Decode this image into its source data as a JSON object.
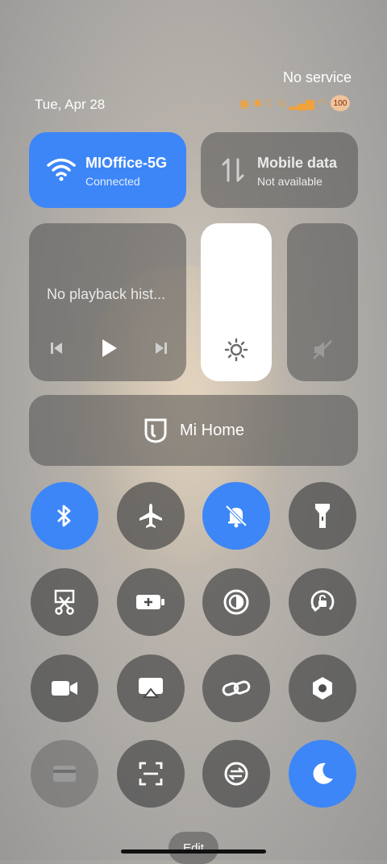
{
  "status": {
    "carrier": "No service",
    "date": "Tue, Apr 28",
    "battery": "100"
  },
  "wifi": {
    "name": "MIOffice-5G",
    "status": "Connected"
  },
  "mobile": {
    "name": "Mobile data",
    "status": "Not available"
  },
  "media": {
    "text": "No playback hist..."
  },
  "mihome": {
    "label": "Mi Home"
  },
  "edit": {
    "label": "Edit"
  },
  "colors": {
    "accent": "#3d86f7",
    "tile": "#505050"
  },
  "toggles": [
    {
      "name": "bluetooth",
      "on": true
    },
    {
      "name": "airplane-mode",
      "on": false
    },
    {
      "name": "silent-mode",
      "on": true
    },
    {
      "name": "flashlight",
      "on": false
    },
    {
      "name": "screenshot",
      "on": false
    },
    {
      "name": "battery-saver",
      "on": false
    },
    {
      "name": "reading-mode",
      "on": false
    },
    {
      "name": "auto-rotate",
      "on": false
    },
    {
      "name": "screen-recorder",
      "on": false
    },
    {
      "name": "cast",
      "on": false
    },
    {
      "name": "mi-share",
      "on": false
    },
    {
      "name": "settings",
      "on": false
    },
    {
      "name": "card",
      "on": false
    },
    {
      "name": "scanner",
      "on": false
    },
    {
      "name": "sync",
      "on": false
    },
    {
      "name": "dark-mode",
      "on": true
    }
  ]
}
